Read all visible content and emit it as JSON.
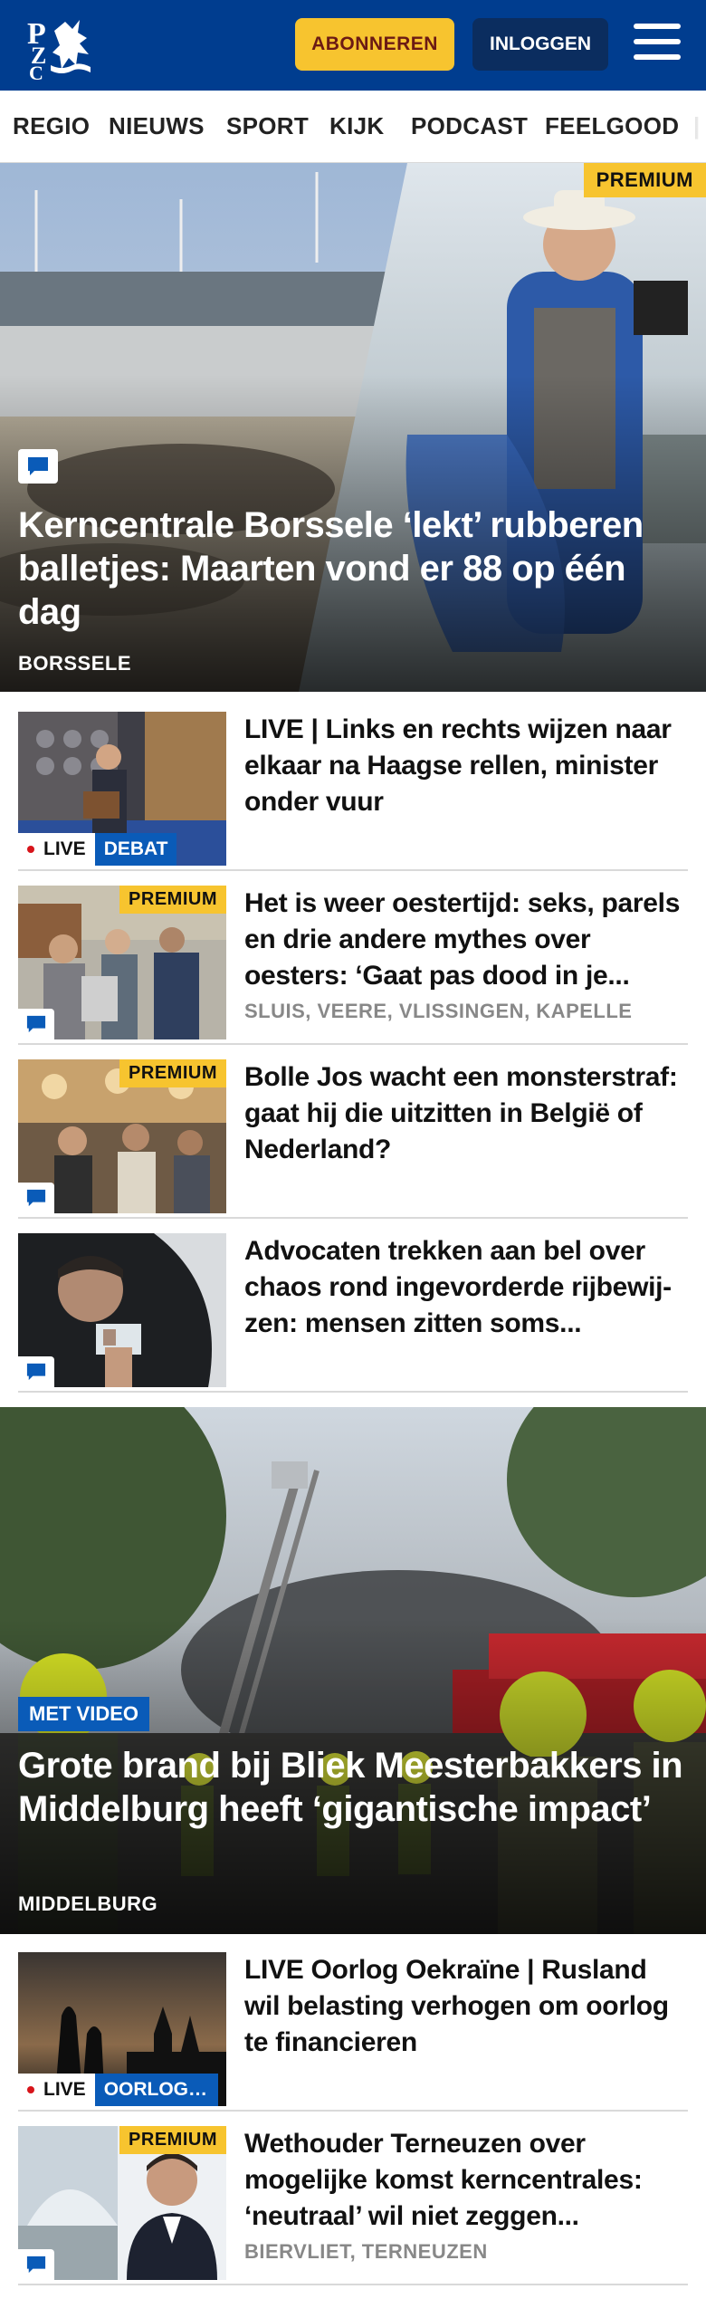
{
  "header": {
    "subscribe_label": "ABONNEREN",
    "login_label": "INLOGGEN"
  },
  "nav": {
    "items": [
      "REGIO",
      "NIEUWS",
      "SPORT",
      "KIJK",
      "PODCAST",
      "FEELGOOD"
    ]
  },
  "colors": {
    "brand_blue": "#003d8f",
    "premium_yellow": "#f7c42f",
    "tag_blue": "#0a5bb8",
    "live_red": "#d7141a"
  },
  "hero1": {
    "badge": "PREMIUM",
    "title": "Kerncentrale Borssele ‘lekt’ rubberen balletjes: Maarten vond er 88 op één dag",
    "location": "BORSSELE"
  },
  "articles": [
    {
      "title": "LIVE | Links en rechts wijzen naar elkaar na Haagse rellen, minister onder vuur",
      "live_label": "LIVE",
      "category": "DEBAT"
    },
    {
      "badge": "PREMIUM",
      "title": "Het is weer oestertijd: seks, parels en drie andere mythes over oesters: ‘Gaat pas dood in je maag’",
      "location": "SLUIS, VEERE, VLISSINGEN, KAPELLE"
    },
    {
      "badge": "PREMIUM",
      "title": "Bolle Jos wacht een monster­straf: gaat hij die uitzitten in België of Nederland?"
    },
    {
      "title": "Advocaten trekken aan bel over chaos rond ingevorderde rijbewij­zen: mensen zitten soms maanden zonder"
    }
  ],
  "hero2": {
    "badge": "MET VIDEO",
    "title": "Grote brand bij Bliek Meesterbakkers in Middelburg heeft ‘gigantische impact’",
    "location": "MIDDELBURG"
  },
  "articles2": [
    {
      "title": "LIVE Oorlog Oekraïne | Rusland wil belasting verhogen om oorlog te financieren",
      "live_label": "LIVE",
      "category": "OORLOG IN OEKRAÏNE"
    },
    {
      "badge": "PREMIUM",
      "title": "Wethouder Terneuzen over mogelijke komst kerncentrales: ‘neutraal’ wil niet zeggen ‘onverschillig’",
      "location": "BIERVLIET, TERNEUZEN"
    }
  ]
}
